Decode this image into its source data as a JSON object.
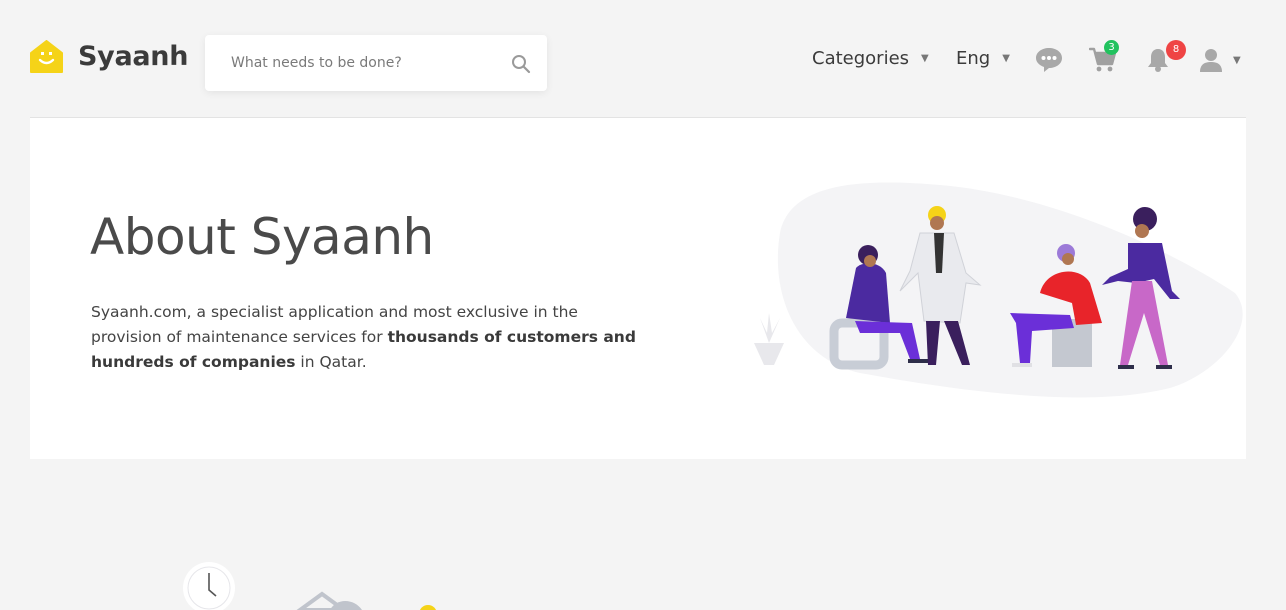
{
  "header": {
    "brand": "Syaanh",
    "search_placeholder": "What needs to be done?",
    "nav": {
      "categories": "Categories",
      "language": "Eng"
    },
    "cart_count": "3",
    "notifications_count": "8",
    "colors": {
      "logo": "#f5d318",
      "cart_badge": "#21c25e",
      "notification_badge": "#ef4444"
    }
  },
  "about": {
    "title": "About Syaanh",
    "text_intro": "Syaanh.com, a specialist application and most exclusive in the provision of maintenance services for ",
    "text_bold1": "thousands of customers and hundreds of companies",
    "text_outro": " in Qatar."
  }
}
